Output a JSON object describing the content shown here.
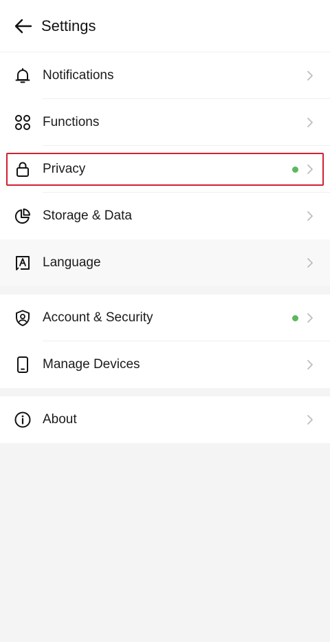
{
  "header": {
    "title": "Settings"
  },
  "groups": [
    {
      "items": [
        {
          "label": "Notifications",
          "icon": "bell-icon",
          "dot": false
        },
        {
          "label": "Functions",
          "icon": "grid-icon",
          "dot": false
        },
        {
          "label": "Privacy",
          "icon": "lock-icon",
          "dot": true
        },
        {
          "label": "Storage & Data",
          "icon": "pie-chart-icon",
          "dot": false
        },
        {
          "label": "Language",
          "icon": "language-icon",
          "dot": false
        }
      ]
    },
    {
      "items": [
        {
          "label": "Account & Security",
          "icon": "shield-user-icon",
          "dot": true
        },
        {
          "label": "Manage Devices",
          "icon": "phone-icon",
          "dot": false
        }
      ]
    },
    {
      "items": [
        {
          "label": "About",
          "icon": "info-icon",
          "dot": false
        }
      ]
    }
  ],
  "colors": {
    "notification_dot": "#5cb85c",
    "highlight_border": "#d2202f",
    "chevron": "#bdbdbd"
  }
}
